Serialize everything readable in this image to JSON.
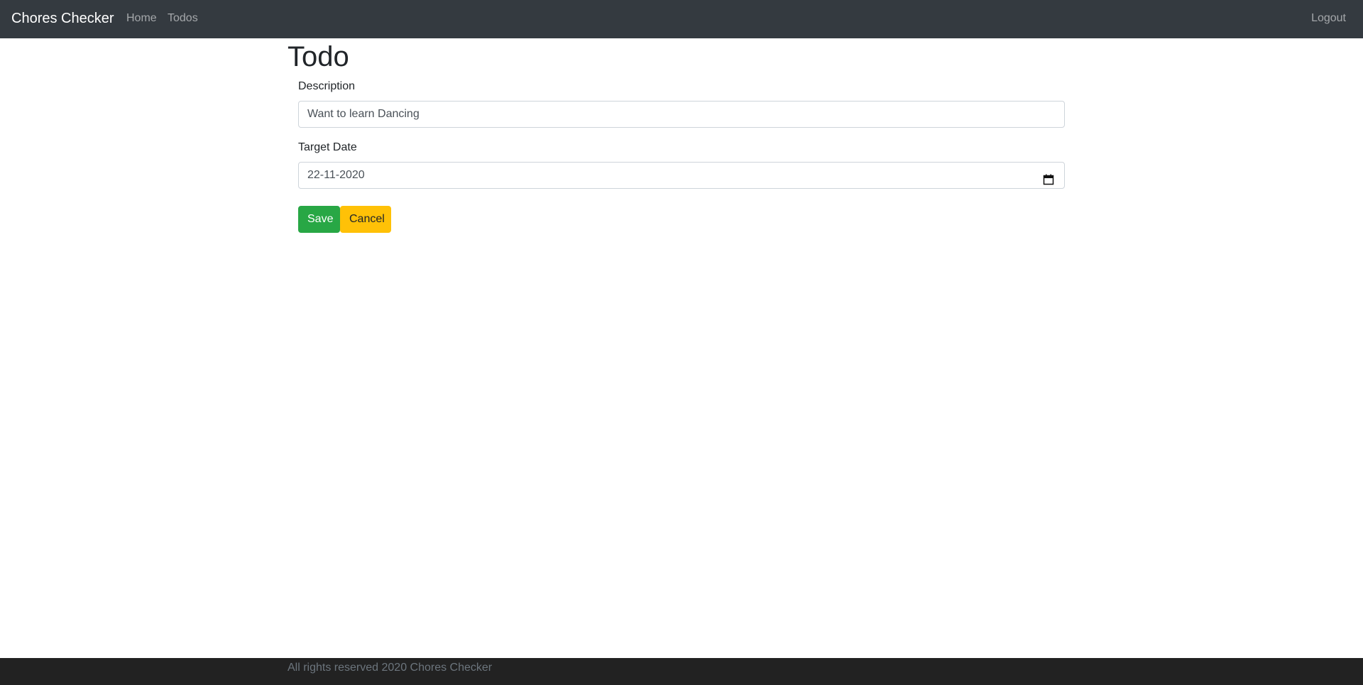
{
  "navbar": {
    "brand": "Chores Checker",
    "links": [
      "Home",
      "Todos"
    ],
    "logout": "Logout"
  },
  "main": {
    "title": "Todo",
    "description_label": "Description",
    "description_value": "Want to learn Dancing",
    "target_date_label": "Target Date",
    "target_date_value": "22-11-2020",
    "save_label": "Save",
    "cancel_label": "Cancel"
  },
  "footer": {
    "text": "All rights reserved 2020 Chores Checker"
  },
  "colors": {
    "navbar": "#343a40",
    "save": "#28a745",
    "cancel": "#ffc107",
    "footer": "#222222"
  },
  "icons": {
    "date_picker": "calendar-icon"
  }
}
